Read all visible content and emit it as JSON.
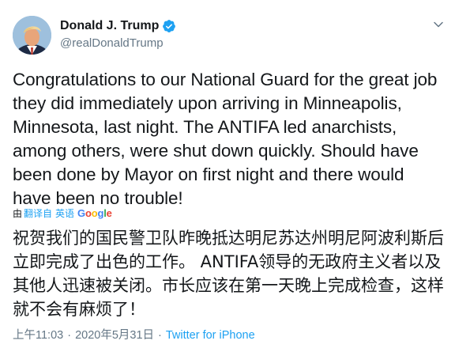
{
  "author": {
    "display_name": "Donald J. Trump",
    "handle": "@realDonaldTrump",
    "verified": true,
    "avatar_icon": "profile-photo"
  },
  "menu_icon": "chevron-down-icon",
  "tweet": {
    "text": "Congratulations to our National Guard for the great job they did immediately upon arriving in Minneapolis, Minnesota, last night. The ANTIFA led anarchists, among others, were shut down quickly. Should have been done by Mayor on first night and there would have been no trouble!"
  },
  "translation": {
    "from_label": "由",
    "translated_from_label": "翻译自",
    "language": "英语",
    "provider": "Google",
    "text": "祝贺我们的国民警卫队昨晚抵达明尼苏达州明尼阿波利斯后立即完成了出色的工作。 ANTIFA领导的无政府主义者以及其他人迅速被关闭。市长应该在第一天晚上完成检查，这样就不会有麻烦了！"
  },
  "meta": {
    "time": "上午11:03",
    "separator": "·",
    "date": "2020年5月31日",
    "source": "Twitter for iPhone"
  },
  "colors": {
    "text": "#14171a",
    "secondary": "#657786",
    "link": "#1da1f2",
    "verified_badge": "#1da1f2"
  }
}
